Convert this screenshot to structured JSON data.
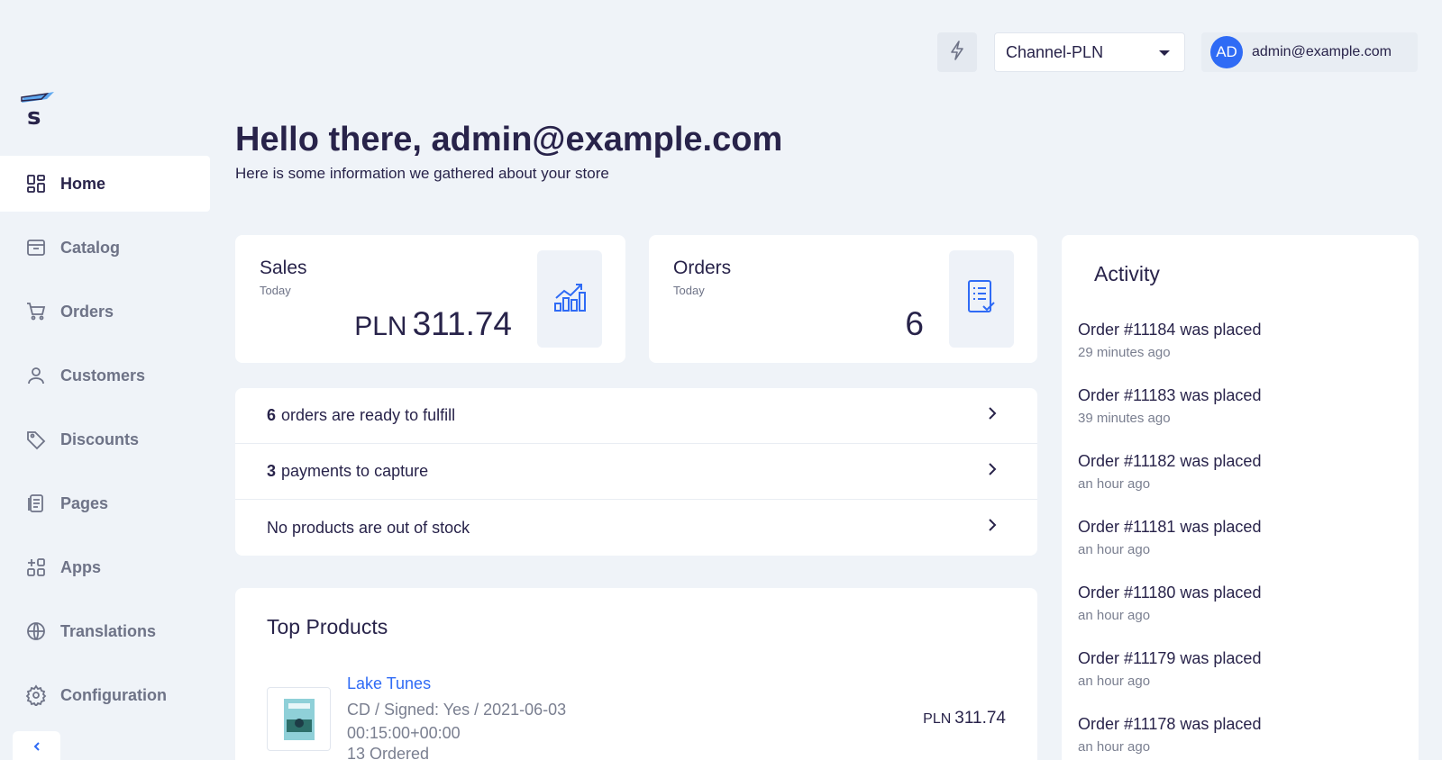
{
  "brand": {
    "logo_letter": "s"
  },
  "sidebar": {
    "items": [
      {
        "label": "Home",
        "icon": "home-grid-icon",
        "active": true
      },
      {
        "label": "Catalog",
        "icon": "catalog-box-icon"
      },
      {
        "label": "Orders",
        "icon": "cart-icon"
      },
      {
        "label": "Customers",
        "icon": "user-icon"
      },
      {
        "label": "Discounts",
        "icon": "tag-icon"
      },
      {
        "label": "Pages",
        "icon": "document-icon"
      },
      {
        "label": "Apps",
        "icon": "apps-plus-icon"
      },
      {
        "label": "Translations",
        "icon": "globe-icon"
      },
      {
        "label": "Configuration",
        "icon": "gear-icon"
      }
    ],
    "collapse_icon": "chevron-left-icon"
  },
  "topbar": {
    "quick_action_icon": "bolt-icon",
    "channel": "Channel-PLN",
    "user_initials": "AD",
    "user_email": "admin@example.com"
  },
  "header": {
    "title": "Hello there, admin@example.com",
    "subtitle": "Here is some information we gathered about your store"
  },
  "stats": {
    "sales": {
      "title": "Sales",
      "period": "Today",
      "currency": "PLN",
      "value": "311.74",
      "icon": "chart-growth-icon"
    },
    "orders": {
      "title": "Orders",
      "period": "Today",
      "value": "6",
      "icon": "checklist-icon"
    }
  },
  "notifications": [
    {
      "count": "6",
      "text": "orders are ready to fulfill"
    },
    {
      "count": "3",
      "text": "payments to capture"
    },
    {
      "count": "",
      "text": "No products are out of stock"
    }
  ],
  "top_products": {
    "title": "Top Products",
    "items": [
      {
        "name": "Lake Tunes",
        "variant": "CD / Signed: Yes / 2021-06-03 00:15:00+00:00",
        "ordered": "13 Ordered",
        "currency": "PLN",
        "price": "311.74"
      }
    ]
  },
  "activity": {
    "title": "Activity",
    "items": [
      {
        "text": "Order #11184 was placed",
        "time": "29 minutes ago"
      },
      {
        "text": "Order #11183 was placed",
        "time": "39 minutes ago"
      },
      {
        "text": "Order #11182 was placed",
        "time": "an hour ago"
      },
      {
        "text": "Order #11181 was placed",
        "time": "an hour ago"
      },
      {
        "text": "Order #11180 was placed",
        "time": "an hour ago"
      },
      {
        "text": "Order #11179 was placed",
        "time": "an hour ago"
      },
      {
        "text": "Order #11178 was placed",
        "time": "an hour ago"
      }
    ]
  },
  "colors": {
    "accent": "#2f6bf5",
    "background": "#eff3f8",
    "text": "#28234a",
    "muted": "#7a7f90"
  }
}
